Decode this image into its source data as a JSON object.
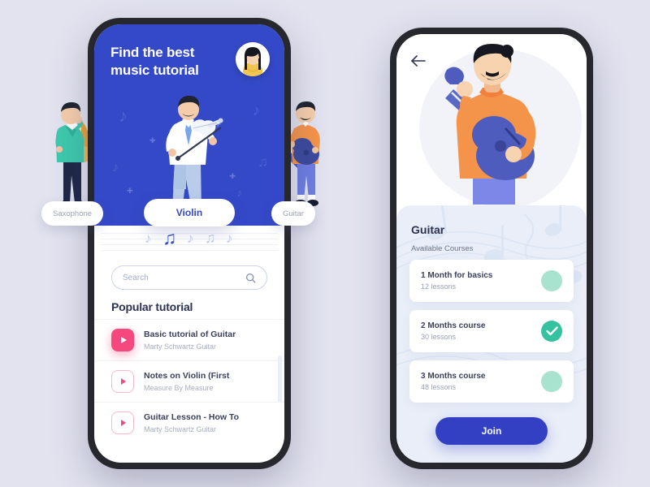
{
  "app": {
    "background_color": "#e2e3ef",
    "brand_blue": "#3449c8",
    "accent_pink": "#f5487f",
    "accent_green": "#35c2a0",
    "join_blue": "#3340c4"
  },
  "phone1": {
    "hero": {
      "title": "Find the best\nmusic tutorial",
      "title_line1": "Find the best",
      "title_line2": "music tutorial",
      "avatar_name": "user-avatar",
      "background_color": "#3449c8"
    },
    "categories": [
      {
        "label": "Saxophone",
        "active": false
      },
      {
        "label": "Violin",
        "active": true
      },
      {
        "label": "Guitar",
        "active": false
      }
    ],
    "search": {
      "placeholder": "Search",
      "value": "",
      "icon": "search-icon"
    },
    "section_title": "Popular tutorial",
    "tutorials": [
      {
        "title": "Basic tutorial of Guitar",
        "author": "Marty Schwartz Guitar",
        "icon": "play-icon",
        "highlighted": true
      },
      {
        "title": "Notes on Violin (First",
        "author": "Measure By Measure",
        "icon": "play-icon",
        "highlighted": false
      },
      {
        "title": "Guitar Lesson - How To",
        "author": "Marty Schwartz Guitar",
        "icon": "play-icon",
        "highlighted": false
      }
    ]
  },
  "phone2": {
    "back_icon": "arrow-left-icon",
    "hero_illustration": "guitar-player-illustration",
    "heading": "Guitar",
    "subheading": "Available Courses",
    "courses": [
      {
        "title": "1 Month for basics",
        "lessons": "12 lessons",
        "selected": false
      },
      {
        "title": "2 Months course",
        "lessons": "30 lessons",
        "selected": true
      },
      {
        "title": "3 Months course",
        "lessons": "48 lessons",
        "selected": false
      }
    ],
    "join_label": "Join"
  }
}
